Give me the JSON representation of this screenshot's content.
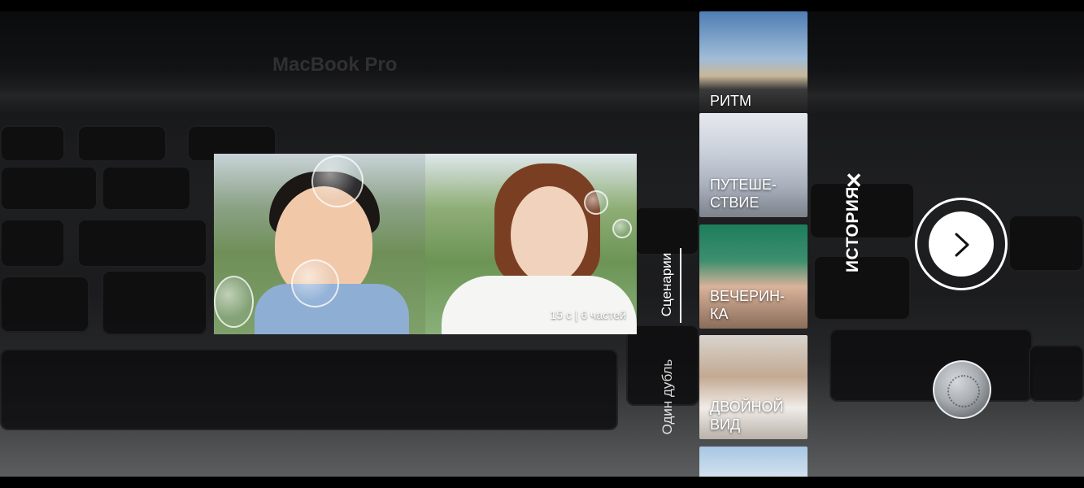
{
  "background": {
    "brand_text": "MacBook Pro"
  },
  "preview": {
    "info": "15 с | 6 частей"
  },
  "modes": {
    "scenarios_label": "Сценарии",
    "single_take_label": "Один дубль",
    "active": "Сценарии"
  },
  "templates": [
    {
      "label": "РИТМ"
    },
    {
      "label": "ПУТЕШЕ-\nСТВИЕ"
    },
    {
      "label": "ВЕЧЕРИН-\nКА"
    },
    {
      "label": "ДВОЙНОЙ\nВИД"
    },
    {
      "label": ""
    }
  ],
  "panel": {
    "title": "ИСТОРИЯ",
    "close_icon": "close-icon",
    "next_icon": "chevron-right-icon"
  },
  "colors": {
    "status_dot": "#3ad36a",
    "accent": "#ffffff"
  }
}
